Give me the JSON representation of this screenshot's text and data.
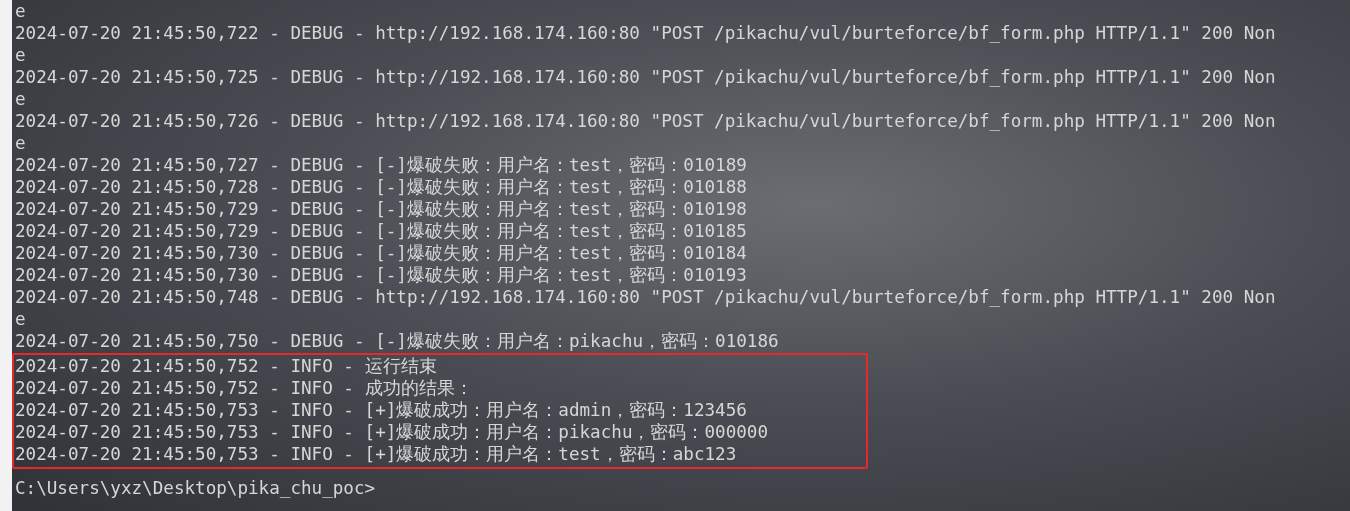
{
  "terminal": {
    "lines": [
      "e",
      "2024-07-20 21:45:50,722 - DEBUG - http://192.168.174.160:80 \"POST /pikachu/vul/burteforce/bf_form.php HTTP/1.1\" 200 Non",
      "e",
      "2024-07-20 21:45:50,725 - DEBUG - http://192.168.174.160:80 \"POST /pikachu/vul/burteforce/bf_form.php HTTP/1.1\" 200 Non",
      "e",
      "2024-07-20 21:45:50,726 - DEBUG - http://192.168.174.160:80 \"POST /pikachu/vul/burteforce/bf_form.php HTTP/1.1\" 200 Non",
      "e",
      "2024-07-20 21:45:50,727 - DEBUG - [-]爆破失败：用户名：test，密码：010189",
      "2024-07-20 21:45:50,728 - DEBUG - [-]爆破失败：用户名：test，密码：010188",
      "2024-07-20 21:45:50,729 - DEBUG - [-]爆破失败：用户名：test，密码：010198",
      "2024-07-20 21:45:50,729 - DEBUG - [-]爆破失败：用户名：test，密码：010185",
      "2024-07-20 21:45:50,730 - DEBUG - [-]爆破失败：用户名：test，密码：010184",
      "2024-07-20 21:45:50,730 - DEBUG - [-]爆破失败：用户名：test，密码：010193",
      "2024-07-20 21:45:50,748 - DEBUG - http://192.168.174.160:80 \"POST /pikachu/vul/burteforce/bf_form.php HTTP/1.1\" 200 Non",
      "e",
      "2024-07-20 21:45:50,750 - DEBUG - [-]爆破失败：用户名：pikachu，密码：010186"
    ],
    "highlighted_lines": [
      "2024-07-20 21:45:50,752 - INFO - 运行结束",
      "2024-07-20 21:45:50,752 - INFO - 成功的结果：",
      "2024-07-20 21:45:50,753 - INFO - [+]爆破成功：用户名：admin，密码：123456",
      "2024-07-20 21:45:50,753 - INFO - [+]爆破成功：用户名：pikachu，密码：000000",
      "2024-07-20 21:45:50,753 - INFO - [+]爆破成功：用户名：test，密码：abc123"
    ],
    "prompt": "C:\\Users\\yxz\\Desktop\\pika_chu_poc>"
  }
}
